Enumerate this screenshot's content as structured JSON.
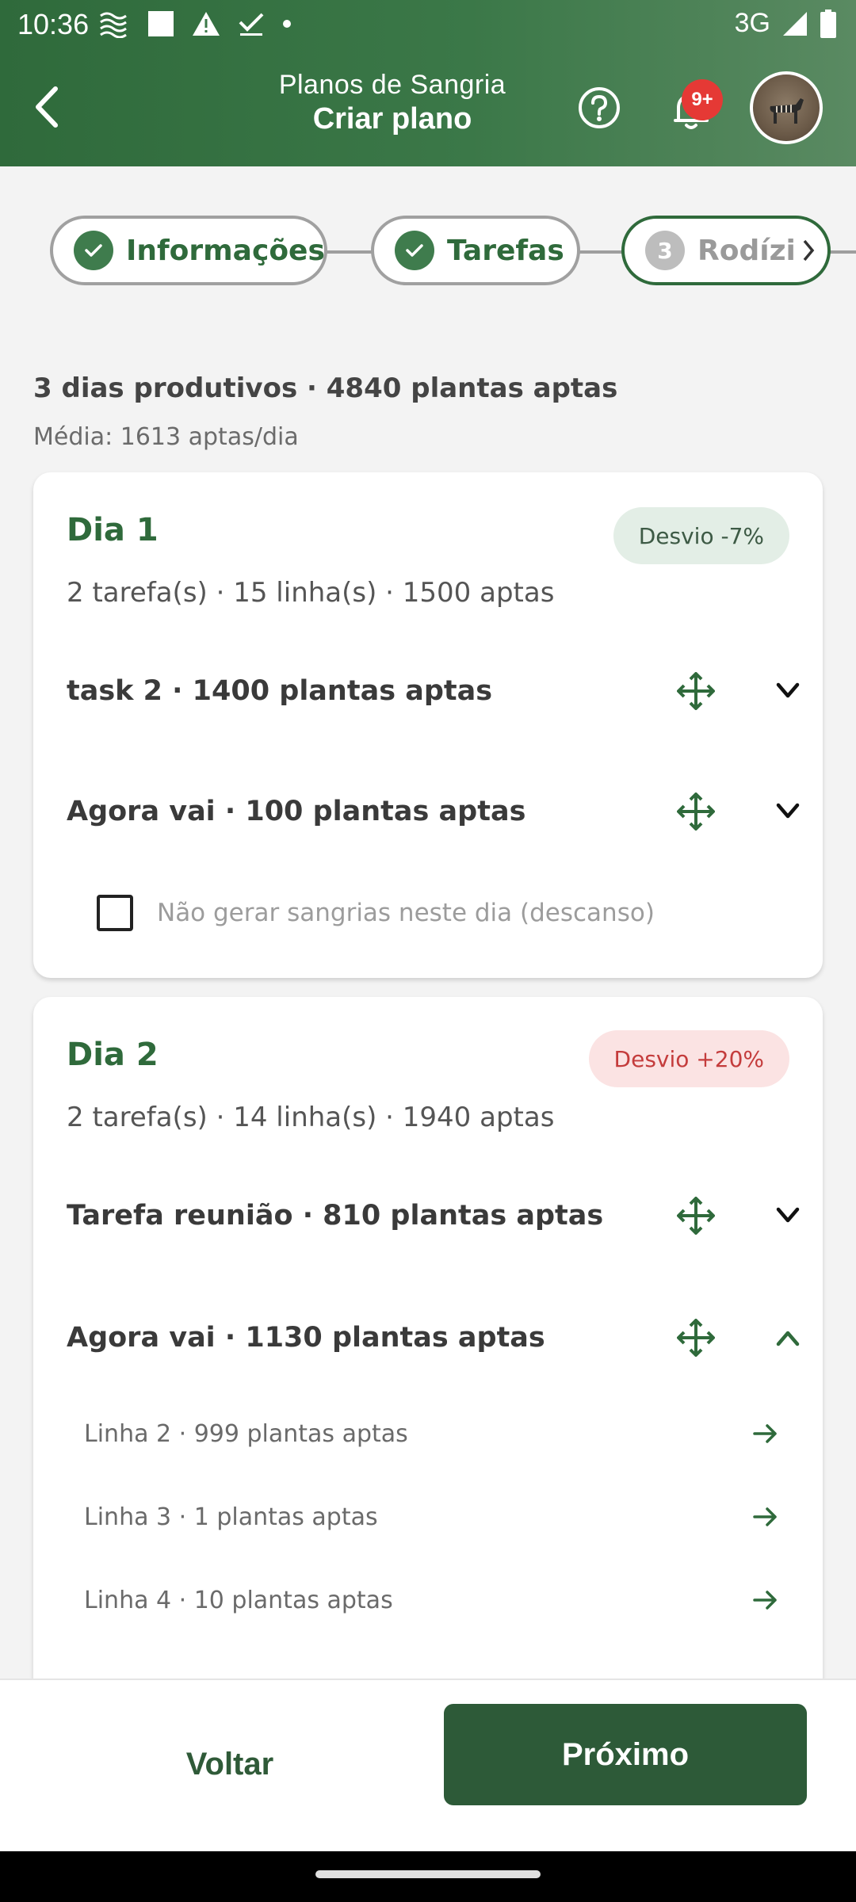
{
  "status_bar": {
    "time": "10:36",
    "network": "3G",
    "left_icons": [
      "wave-icon",
      "square-icon",
      "warning-icon",
      "check-icon",
      "dot-icon"
    ],
    "right_icons": [
      "signal-icon",
      "battery-icon"
    ]
  },
  "header": {
    "subtitle": "Planos de Sangria",
    "title": "Criar plano",
    "notification_badge": "9+"
  },
  "stepper": {
    "steps": [
      {
        "label": "Informações",
        "status": "done"
      },
      {
        "label": "Tarefas",
        "status": "done"
      },
      {
        "label": "Rodízio",
        "number": "3",
        "status": "current"
      }
    ]
  },
  "summary": {
    "headline": "3 dias produtivos · 4840 plantas aptas",
    "average": "Média: 1613 aptas/dia"
  },
  "days": [
    {
      "title": "Dia 1",
      "deviation": "Desvio -7%",
      "deviation_tone": "green",
      "stats": "2 tarefa(s) · 15 linha(s) · 1500 aptas",
      "tasks": [
        {
          "label": "task 2 · 1400 plantas aptas",
          "expanded": false
        },
        {
          "label": "Agora vai · 100 plantas aptas",
          "expanded": false
        }
      ],
      "rest_checkbox": {
        "label": "Não gerar sangrias neste dia (descanso)",
        "checked": false
      }
    },
    {
      "title": "Dia 2",
      "deviation": "Desvio +20%",
      "deviation_tone": "red",
      "stats": "2 tarefa(s) · 14 linha(s) · 1940 aptas",
      "tasks": [
        {
          "label": "Tarefa reunião · 810 plantas aptas",
          "expanded": false
        },
        {
          "label": "Agora vai · 1130 plantas aptas",
          "expanded": true
        }
      ],
      "lines": [
        "Linha 2 · 999 plantas aptas",
        "Linha 3 · 1 plantas aptas",
        "Linha 4 · 10 plantas aptas"
      ]
    }
  ],
  "footer": {
    "back_label": "Voltar",
    "next_label": "Próximo"
  },
  "colors": {
    "primary": "#2f6a3b",
    "header_gradient_end": "#5a8a62",
    "badge_red": "#e53935",
    "deviation_green_bg": "#e3eee6",
    "deviation_red_bg": "#fbe3e3",
    "deviation_red_text": "#c43c3c"
  }
}
